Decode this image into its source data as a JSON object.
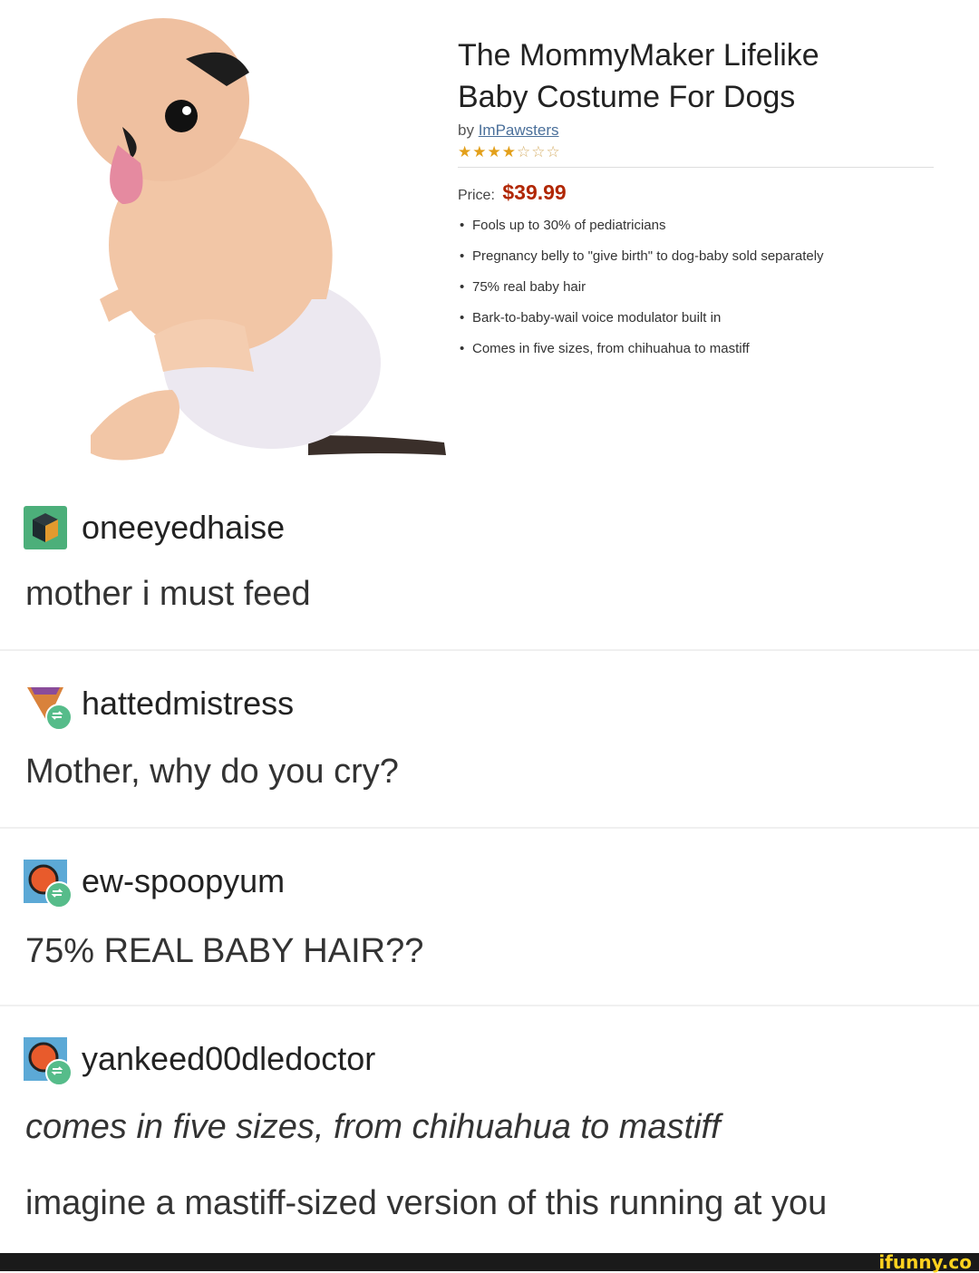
{
  "product": {
    "title_line1": "The MommyMaker Lifelike",
    "title_line2": "Baby Costume For Dogs",
    "by_label": "by",
    "brand": "ImPawsters",
    "rating": {
      "filled": 4,
      "total": 7
    },
    "price_label": "Price:",
    "price": "$39.99",
    "bullets": [
      "Fools up to 30% of pediatricians",
      "Pregnancy belly to \"give birth\" to dog-baby sold separately",
      "75% real baby hair",
      "Bark-to-baby-wail voice modulator built in",
      "Comes in five sizes, from chihuahua to mastiff"
    ],
    "colors": {
      "price": "#b12704",
      "star": "#e3a01b"
    }
  },
  "posts": [
    {
      "username": "oneeyedhaise",
      "avatar_icon": "cube-icon",
      "reblog": false,
      "lines": [
        "mother i must feed"
      ]
    },
    {
      "username": "hattedmistress",
      "avatar_icon": "witch-hat-icon",
      "reblog": true,
      "lines": [
        "Mother, why do you cry?"
      ]
    },
    {
      "username": "ew-spoopyum",
      "avatar_icon": "orange-circle-avatar-icon",
      "reblog": true,
      "lines": [
        "75% REAL BABY HAIR??"
      ]
    },
    {
      "username": "yankeed00dledoctor",
      "avatar_icon": "orange-circle-avatar-icon",
      "reblog": true,
      "lines": [
        "comes in five sizes, from chihuahua to mastiff",
        "imagine a mastiff-sized version of this running at you"
      ]
    }
  ],
  "watermark": "ifunny.co"
}
